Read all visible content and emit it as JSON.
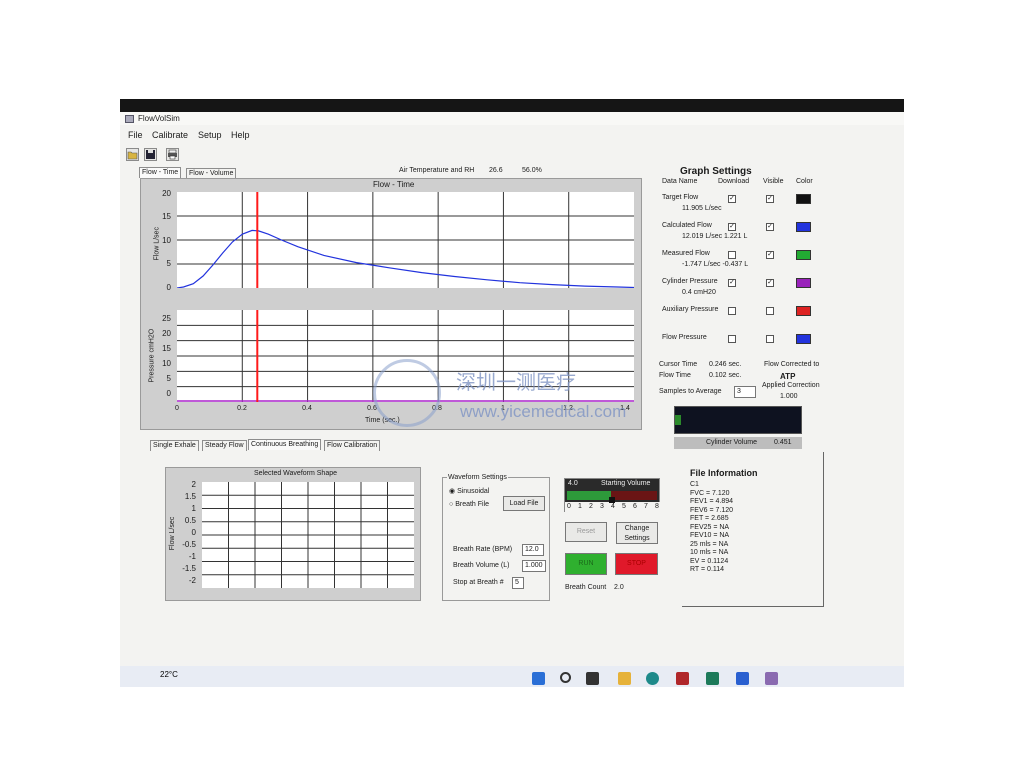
{
  "app": {
    "title": "FlowVolSim"
  },
  "menu": [
    "File",
    "Calibrate",
    "Setup",
    "Help"
  ],
  "toolbar": {
    "icons": [
      "open-folder-icon",
      "save-icon",
      "print-icon"
    ]
  },
  "top_tabs": [
    "Flow - Time",
    "Flow - Volume"
  ],
  "air": {
    "label": "Air Temperature and RH",
    "temp": "26.6",
    "rh": "56.0%"
  },
  "flow_chart": {
    "title": "Flow - Time",
    "ylabel": "Flow L/sec",
    "yticks": [
      "20",
      "15",
      "10",
      "5",
      "0"
    ],
    "chart_data": {
      "type": "line",
      "title": "Flow - Time",
      "ylabel": "Flow L/sec",
      "xlabel": "Time (sec.)",
      "xlim": [
        0,
        1.4
      ],
      "ylim": [
        0,
        20
      ],
      "series": [
        {
          "x": [
            0,
            0.02,
            0.05,
            0.08,
            0.11,
            0.14,
            0.17,
            0.2,
            0.23,
            0.25,
            0.28,
            0.32,
            0.37,
            0.45,
            0.55,
            0.65,
            0.75,
            0.85,
            0.95,
            1.05,
            1.15,
            1.25,
            1.35,
            1.4
          ],
          "y": [
            0,
            0.2,
            0.9,
            2.5,
            4.8,
            7.3,
            9.6,
            11.2,
            12.0,
            11.9,
            11.2,
            10.0,
            8.6,
            6.8,
            5.3,
            4.2,
            3.2,
            2.4,
            1.7,
            1.1,
            0.7,
            0.4,
            0.2,
            0.1
          ]
        }
      ],
      "cursor_x": 0.246
    }
  },
  "pressure_chart": {
    "ylabel": "Pressure cmH2O",
    "yticks": [
      "25",
      "20",
      "15",
      "10",
      "5",
      "0"
    ],
    "xticks": [
      "0",
      "0.2",
      "0.4",
      "0.6",
      "0.8",
      "1",
      "1.2",
      "1.4"
    ],
    "xlabel": "Time (sec.)",
    "chart_data": {
      "type": "line",
      "ylabel": "Pressure cmH2O",
      "xlabel": "Time (sec.)",
      "xlim": [
        0,
        1.4
      ],
      "ylim": [
        0,
        30
      ],
      "series": [
        {
          "x": [
            0,
            1.4
          ],
          "y": [
            0,
            0
          ]
        }
      ]
    }
  },
  "bottom_tabs": [
    "Single Exhale",
    "Steady Flow",
    "Continuous Breathing",
    "Flow Calibration"
  ],
  "waveform_chart": {
    "title": "Selected Waveform Shape",
    "ylabel": "Flow L/sec",
    "yticks": [
      "2",
      "1.5",
      "1",
      "0.5",
      "0",
      "-0.5",
      "-1",
      "-1.5",
      "-2"
    ],
    "chart_data": {
      "type": "line",
      "title": "Selected Waveform Shape",
      "ylabel": "Flow L/sec",
      "ylim": [
        -2,
        2
      ],
      "series": []
    }
  },
  "waveform_settings": {
    "title": "Waveform Settings",
    "opt1": "Sinusoidal",
    "opt2": "Breath File",
    "load_file": "Load File",
    "breath_rate_label": "Breath Rate (BPM)",
    "breath_rate": "12.0",
    "breath_volume_label": "Breath Volume (L)",
    "breath_volume": "1.000",
    "stop_label": "Stop at Breath #",
    "stop_value": "5"
  },
  "volume_ctrl": {
    "value": "4.0",
    "label": "Starting Volume",
    "scale": [
      "0",
      "1",
      "2",
      "3",
      "4",
      "5",
      "6",
      "7",
      "8"
    ],
    "reset": "Reset",
    "change_settings": "Change Settings",
    "run": "RUN",
    "stop": "STOP",
    "breath_count_label": "Breath Count",
    "breath_count": "2.0",
    "slider_level": 0.5
  },
  "graph_settings": {
    "title": "Graph Settings",
    "headers": {
      "name": "Data Name",
      "download": "Download",
      "visible": "Visible",
      "color": "Color"
    },
    "rows": [
      {
        "name": "Target Flow",
        "value": "11.905 L/sec",
        "download": true,
        "visible": true,
        "color": "#111111"
      },
      {
        "name": "Calculated Flow",
        "value": "12.019 L/sec   1.221 L",
        "download": true,
        "visible": true,
        "color": "#2233dd"
      },
      {
        "name": "Measured Flow",
        "value": "-1.747 L/sec  -0.437 L",
        "download": false,
        "visible": true,
        "color": "#22aa33"
      },
      {
        "name": "Cylinder Pressure",
        "value": "0.4 cmH20",
        "download": true,
        "visible": true,
        "color": "#9922bb"
      },
      {
        "name": "Auxiliary Pressure",
        "value": "",
        "download": false,
        "visible": false,
        "color": "#dd2222"
      },
      {
        "name": "Flow Pressure",
        "value": "",
        "download": false,
        "visible": false,
        "color": "#2233dd"
      }
    ],
    "cursor_time_label": "Cursor Time",
    "cursor_time": "0.246 sec.",
    "flow_time_label": "Flow Time",
    "flow_time": "0.102 sec.",
    "corrected_label": "Flow Corrected to",
    "corrected_value": "ATP",
    "applied_label": "Applied Correction",
    "applied_value": "1.000",
    "samples_label": "Samples to Average",
    "samples": "3"
  },
  "cylinder": {
    "label": "Cylinder Volume",
    "value": "0.451",
    "fill_fraction": 0.05
  },
  "file_info": {
    "title": "File Information",
    "lines": [
      "C1",
      "FVC = 7.120",
      "FEV1 = 4.894",
      "FEV6 = 7.120",
      "FET = 2.685",
      "FEV25 = NA",
      "FEV10 = NA",
      "25 mls = NA",
      "10 mls = NA",
      "EV = 0.1124",
      "RT = 0.114"
    ]
  },
  "watermark": {
    "cn": "深圳一测医疗",
    "url": "www.yicemedical.com"
  },
  "taskbar": {
    "temp": "22°C"
  }
}
